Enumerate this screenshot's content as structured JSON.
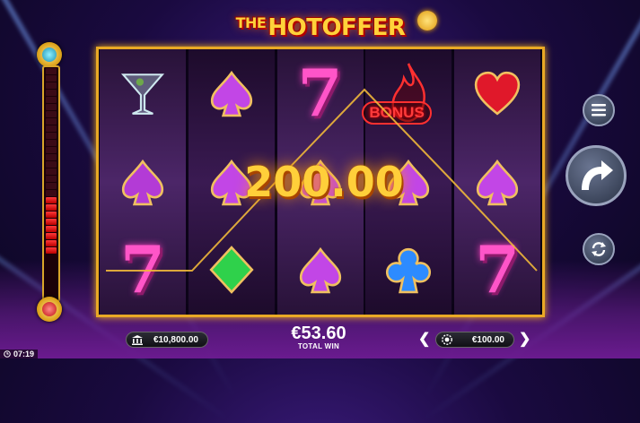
{
  "title": {
    "small": "THE",
    "main": "HOTOFFER"
  },
  "reels": [
    [
      {
        "type": "martini"
      },
      {
        "type": "spade",
        "color": "#b33bd6"
      },
      {
        "type": "seven"
      }
    ],
    [
      {
        "type": "spade",
        "color": "#c246e6"
      },
      {
        "type": "spade",
        "color": "#c246e6"
      },
      {
        "type": "diamond",
        "color": "#2fd14b"
      }
    ],
    [
      {
        "type": "seven"
      },
      {
        "type": "spade",
        "color": "#c246e6"
      },
      {
        "type": "spade",
        "color": "#c246e6"
      }
    ],
    [
      {
        "type": "bonus",
        "label": "BONUS"
      },
      {
        "type": "spade",
        "color": "#c246e6"
      },
      {
        "type": "club",
        "color": "#2d8bff"
      }
    ],
    [
      {
        "type": "heart",
        "color": "#e0182a"
      },
      {
        "type": "spade",
        "color": "#c246e6"
      },
      {
        "type": "seven"
      }
    ]
  ],
  "win_amount": "200.00",
  "bottom": {
    "balance": "€10,800.00",
    "total_win": "€53.60",
    "total_win_label": "TOTAL WIN",
    "bet": "€100.00",
    "clock": "07:19"
  },
  "meter": {
    "segments": 26,
    "filled": 8
  },
  "icons": {
    "menu": "hamburger-icon",
    "spin": "spin-arrow-icon",
    "autoplay": "autoplay-icon",
    "balance": "bank-icon",
    "bet": "chip-icon"
  },
  "colors": {
    "frame": "#e9a925",
    "win": "#ffcf3a",
    "payline": "#f0b83a"
  }
}
